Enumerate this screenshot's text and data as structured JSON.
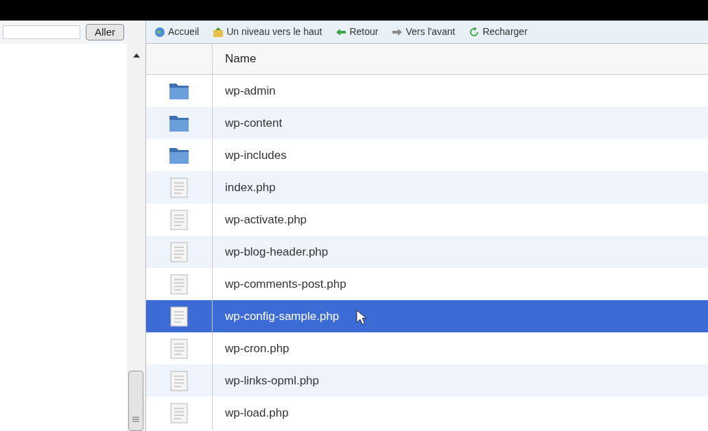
{
  "address_bar": {
    "button": "Aller"
  },
  "toolbar": [
    {
      "kind": "home",
      "label": "Accueil"
    },
    {
      "kind": "up",
      "label": "Un niveau vers le haut"
    },
    {
      "kind": "back",
      "label": "Retour"
    },
    {
      "kind": "forward",
      "label": "Vers l'avant"
    },
    {
      "kind": "reload",
      "label": "Recharger"
    }
  ],
  "table": {
    "columns": [
      "Name"
    ],
    "rows": [
      {
        "kind": "folder",
        "name": "wp-admin",
        "selected": false
      },
      {
        "kind": "folder",
        "name": "wp-content",
        "selected": false
      },
      {
        "kind": "folder",
        "name": "wp-includes",
        "selected": false
      },
      {
        "kind": "file",
        "name": "index.php",
        "selected": false
      },
      {
        "kind": "file",
        "name": "wp-activate.php",
        "selected": false
      },
      {
        "kind": "file",
        "name": "wp-blog-header.php",
        "selected": false
      },
      {
        "kind": "file",
        "name": "wp-comments-post.php",
        "selected": false
      },
      {
        "kind": "file",
        "name": "wp-config-sample.php",
        "selected": true
      },
      {
        "kind": "file",
        "name": "wp-cron.php",
        "selected": false
      },
      {
        "kind": "file",
        "name": "wp-links-opml.php",
        "selected": false
      },
      {
        "kind": "file",
        "name": "wp-load.php",
        "selected": false
      }
    ]
  }
}
